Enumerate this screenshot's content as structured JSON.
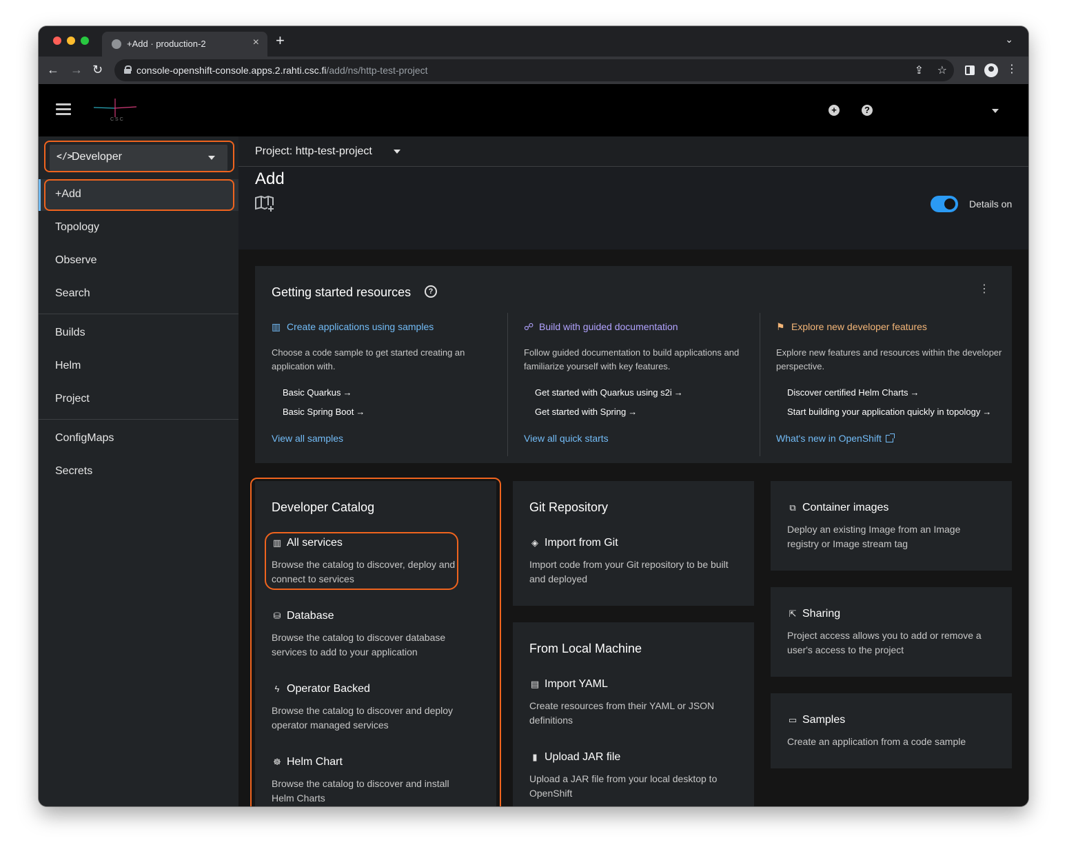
{
  "browser": {
    "tab_title": "+Add · production-2",
    "tab_close": "×",
    "new_tab": "+",
    "tab_menu": "⌄",
    "url_host": "console-openshift-console.apps.2.rahti.csc.fi",
    "url_path": "/add/ns/http-test-project",
    "back": "←",
    "forward": "→",
    "reload": "↻",
    "share": "⇪",
    "star": "☆",
    "kebab": "⋮"
  },
  "masthead": {
    "logo_text": "CSC",
    "plus": "+",
    "help": "?"
  },
  "sidebar": {
    "perspective_icon": "</>",
    "perspective": "Developer",
    "items": [
      {
        "label": "+Add"
      },
      {
        "label": "Topology"
      },
      {
        "label": "Observe"
      },
      {
        "label": "Search"
      },
      {
        "label": "Builds"
      },
      {
        "label": "Helm"
      },
      {
        "label": "Project"
      },
      {
        "label": "ConfigMaps"
      },
      {
        "label": "Secrets"
      }
    ]
  },
  "project": {
    "label": "Project: http-test-project"
  },
  "page": {
    "title": "Add",
    "details_label": "Details on",
    "details_on": true
  },
  "getting_started": {
    "title": "Getting started resources",
    "help": "?",
    "kebab": "⋮",
    "columns": [
      {
        "icon": "book-icon",
        "title": "Create applications using samples",
        "description": "Choose a code sample to get started creating an application with.",
        "links": [
          "Basic Quarkus",
          "Basic Spring Boot"
        ],
        "more": "View all samples",
        "color": "#73bcf7"
      },
      {
        "icon": "route-icon",
        "title": "Build with guided documentation",
        "description": "Follow guided documentation to build applications and familiarize yourself with key features.",
        "links": [
          "Get started with Quarkus using s2i",
          "Get started with Spring"
        ],
        "more": "View all quick starts",
        "color": "#b2a3ff"
      },
      {
        "icon": "flag-icon",
        "title": "Explore new developer features",
        "description": "Explore new features and resources within the developer perspective.",
        "links": [
          "Discover certified Helm Charts",
          "Start building your application quickly in topology"
        ],
        "more": "What's new in OpenShift",
        "color": "#f4b678"
      }
    ],
    "arrow": "→"
  },
  "developer_catalog": {
    "title": "Developer Catalog",
    "items": [
      {
        "icon": "book-icon",
        "title": "All services",
        "description": "Browse the catalog to discover, deploy and connect to services"
      },
      {
        "icon": "database-icon",
        "title": "Database",
        "description": "Browse the catalog to discover database services to add to your application"
      },
      {
        "icon": "bolt-icon",
        "title": "Operator Backed",
        "description": "Browse the catalog to discover and deploy operator managed services"
      },
      {
        "icon": "helm-icon",
        "title": "Helm Chart",
        "description": "Browse the catalog to discover and install Helm Charts"
      }
    ]
  },
  "git_repository": {
    "title": "Git Repository",
    "items": [
      {
        "icon": "git-icon",
        "title": "Import from Git",
        "description": "Import code from your Git repository to be built and deployed"
      }
    ]
  },
  "local_machine": {
    "title": "From Local Machine",
    "items": [
      {
        "icon": "file-code-icon",
        "title": "Import YAML",
        "description": "Create resources from their YAML or JSON definitions"
      },
      {
        "icon": "file-upload-icon",
        "title": "Upload JAR file",
        "description": "Upload a JAR file from your local desktop to OpenShift"
      }
    ]
  },
  "container_images": {
    "icon": "cube-stack-icon",
    "title": "Container images",
    "description": "Deploy an existing Image from an Image registry or Image stream tag"
  },
  "sharing": {
    "icon": "share-icon",
    "title": "Sharing",
    "description": "Project access allows you to add or remove a user's access to the project"
  },
  "samples": {
    "icon": "laptop-icon",
    "title": "Samples",
    "description": "Create an application from a code sample"
  },
  "colors": {
    "highlight": "#f0641e",
    "link": "#73bcf7",
    "toggle": "#2b9af3"
  }
}
